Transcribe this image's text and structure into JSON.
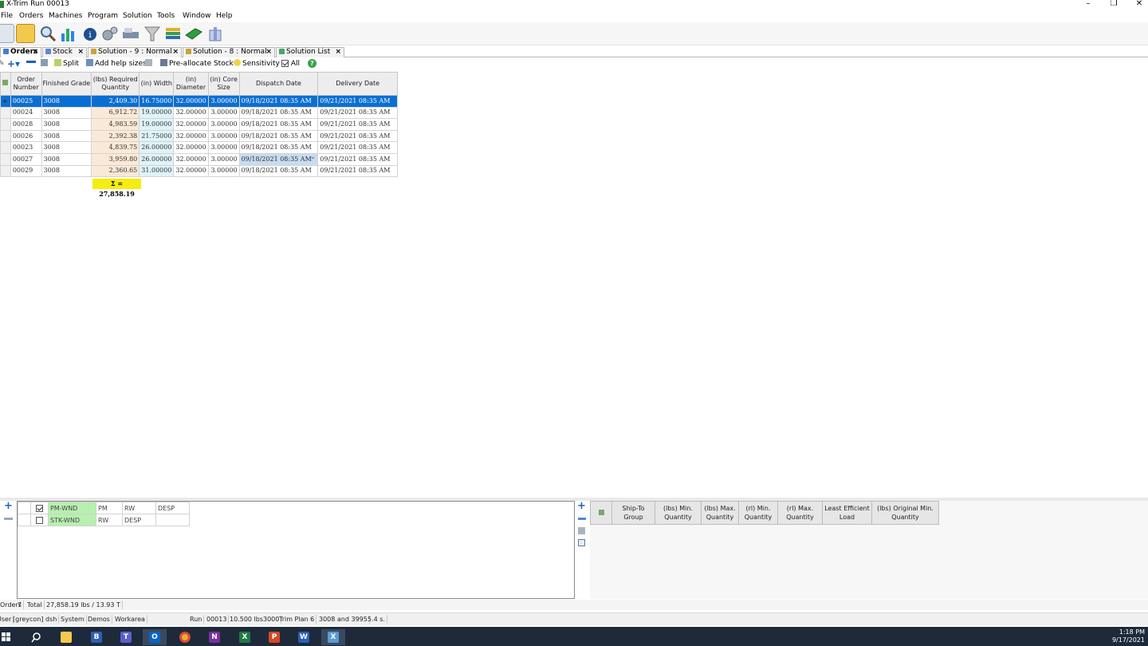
{
  "window": {
    "title": "X-Trim Run 00013"
  },
  "menu": [
    "File",
    "Orders",
    "Machines",
    "Program",
    "Solution",
    "Tools",
    "Window",
    "Help"
  ],
  "toolbar_icons": [
    "new-file-icon",
    "open-folder-icon",
    "search-magnifier-icon",
    "bar-chart-icon",
    "info-icon",
    "settings-gears-icon",
    "machine-icon",
    "filter-funnel-icon",
    "books-icon",
    "green-book-icon",
    "gift-basket-icon"
  ],
  "tabs": [
    {
      "label": "Orders",
      "active": true
    },
    {
      "label": "Stock",
      "active": false
    },
    {
      "label": "Solution - 9 : Normal",
      "active": false
    },
    {
      "label": "Solution - 8 : Normal",
      "active": false
    },
    {
      "label": "Solution List",
      "active": false
    }
  ],
  "orders_toolbar": {
    "split": "Split",
    "add_help_sizes": "Add help sizes",
    "pre_allocate": "Pre-allocate Stock",
    "sensitivity": "Sensitivity",
    "all": "All"
  },
  "orders_grid": {
    "columns": [
      "Order Number",
      "Finished Grade",
      "(lbs) Required Quantity",
      "(in) Width",
      "(in) Diameter",
      "(in) Core Size",
      "Dispatch Date",
      "Delivery Date"
    ],
    "rows": [
      [
        "00025",
        "3008",
        "2,409.30",
        "16.75000",
        "32.00000",
        "3.00000",
        "09/18/2021 08:35 AM",
        "09/21/2021 08:35 AM"
      ],
      [
        "00024",
        "3008",
        "6,912.72",
        "19.00000",
        "32.00000",
        "3.00000",
        "09/18/2021 08:35 AM",
        "09/21/2021 08:35 AM"
      ],
      [
        "00028",
        "3008",
        "4,983.59",
        "19.00000",
        "32.00000",
        "3.00000",
        "09/18/2021 08:35 AM",
        "09/21/2021 08:35 AM"
      ],
      [
        "00026",
        "3008",
        "2,392.38",
        "21.75000",
        "32.00000",
        "3.00000",
        "09/18/2021 08:35 AM",
        "09/21/2021 08:35 AM"
      ],
      [
        "00023",
        "3008",
        "4,839.75",
        "26.00000",
        "32.00000",
        "3.00000",
        "09/18/2021 08:35 AM",
        "09/21/2021 08:35 AM"
      ],
      [
        "00027",
        "3008",
        "3,959.80",
        "26.00000",
        "32.00000",
        "3.00000",
        "09/18/2021 08:35 AM",
        "09/21/2021 08:35 AM"
      ],
      [
        "00029",
        "3008",
        "2,360.65",
        "31.00000",
        "32.00000",
        "3.00000",
        "09/18/2021 08:35 AM",
        "09/21/2021 08:35 AM"
      ]
    ],
    "selected_row": 0,
    "sum_label": "Σ = 27,858.19"
  },
  "machines_grid": {
    "rows": [
      {
        "checked": true,
        "name": "PM-WND",
        "c1": "PM",
        "c2": "RW",
        "c3": "DESP"
      },
      {
        "checked": false,
        "name": "STK-WND",
        "c1": "RW",
        "c2": "DESP",
        "c3": ""
      }
    ]
  },
  "right_grid": {
    "columns": [
      "Ship-To Group",
      "(lbs) Min. Quantity",
      "(lbs) Max. Quantity",
      "(rl) Min. Quantity",
      "(rl) Max. Quantity",
      "Least Efficient Load",
      "(lbs) Original Min. Quantity"
    ]
  },
  "status1": [
    "Orders",
    "7",
    "Total",
    "27,858.19 lbs / 13.93 T"
  ],
  "status2": [
    "User",
    "[greycon] dsh",
    "System",
    "Demos",
    "Workarea",
    "",
    "Run",
    "00013",
    "10.500 lbs3000",
    "Trim Plan 6",
    "3008 and 3995",
    "5.4 s."
  ],
  "taskbar": {
    "apps": [
      "windows-start-icon",
      "search-icon",
      "file-explorer-icon",
      "app-icon",
      "teams-icon",
      "outlook-icon",
      "chrome-icon",
      "onenote-icon",
      "excel-icon",
      "powerpoint-icon",
      "word-icon",
      "xtrim-icon"
    ],
    "time": "1:18 PM",
    "date": "9/17/2021"
  }
}
